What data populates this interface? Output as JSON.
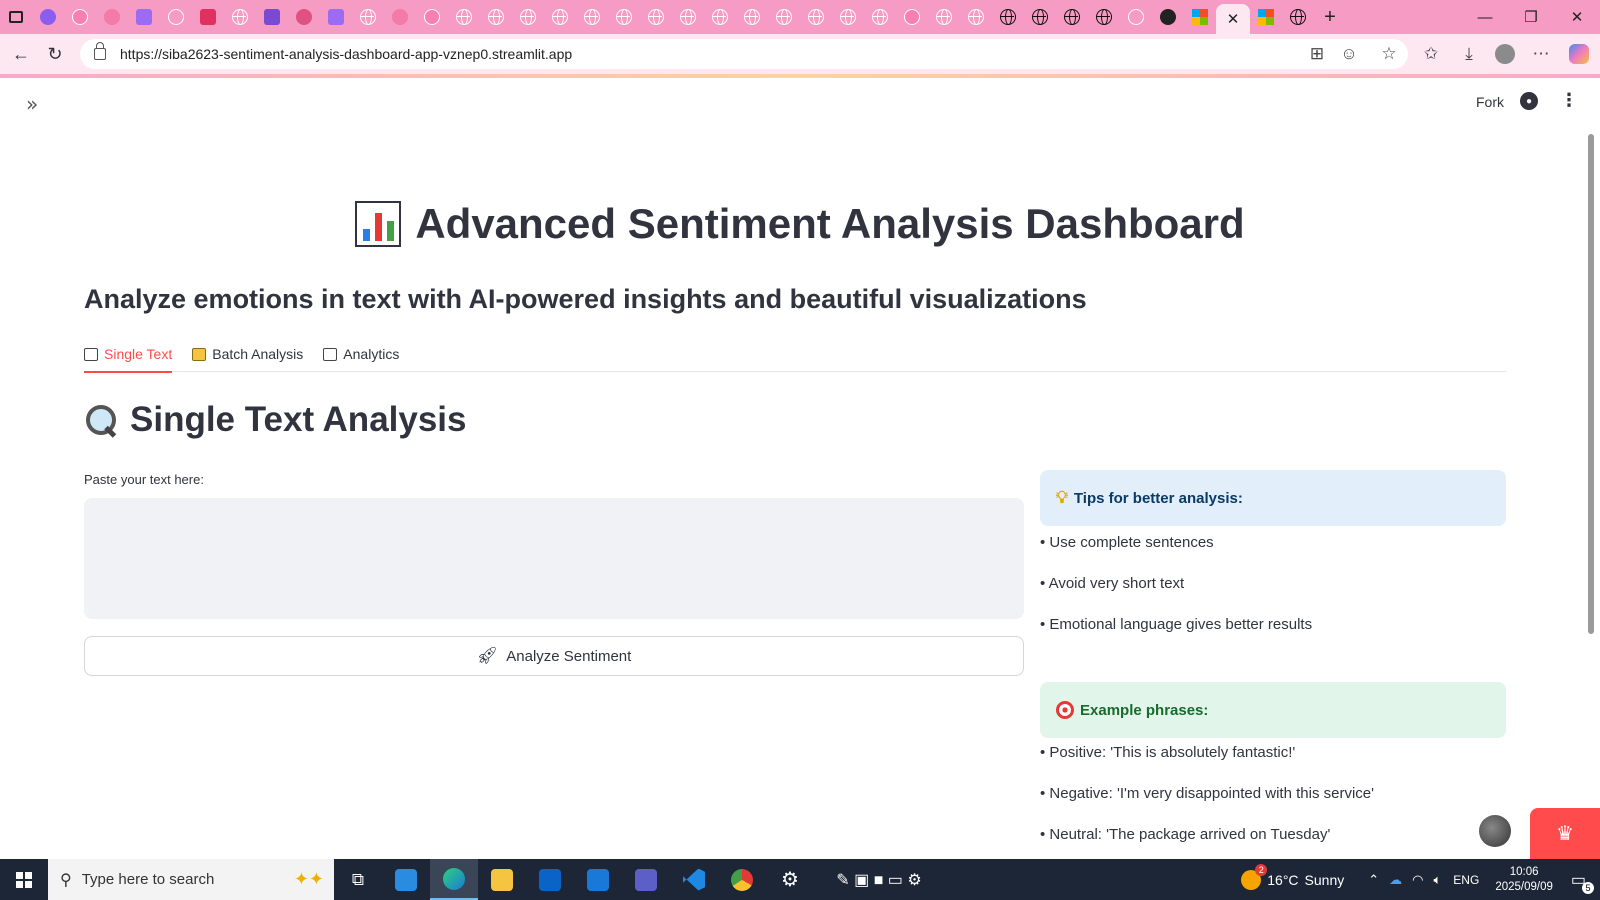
{
  "browser": {
    "url": "https://siba2623-sentiment-analysis-dashboard-app-vznep0.streamlit.app",
    "active_tab_close": "✕",
    "new_tab": "+"
  },
  "header": {
    "fork_label": "Fork"
  },
  "main": {
    "title": "Advanced Sentiment Analysis Dashboard",
    "subtitle": "Analyze emotions in text with AI-powered insights and beautiful visualizations",
    "tabs": [
      {
        "label": "Single Text",
        "active": true
      },
      {
        "label": "Batch Analysis",
        "active": false
      },
      {
        "label": "Analytics",
        "active": false
      }
    ],
    "section_title": "Single Text Analysis",
    "text_label": "Paste your text here:",
    "text_value": "",
    "analyze_label": "Analyze Sentiment"
  },
  "tips": {
    "heading": "Tips for better analysis:",
    "items": [
      "• Use complete sentences",
      "• Avoid very short text",
      "• Emotional language gives better results"
    ]
  },
  "examples": {
    "heading": "Example phrases:",
    "items": [
      "• Positive: 'This is absolutely fantastic!'",
      "• Negative: 'I'm very disappointed with this service'",
      "• Neutral: 'The package arrived on Tuesday'"
    ]
  },
  "taskbar": {
    "search_placeholder": "Type here to search",
    "weather_temp": "16°C",
    "weather_cond": "Sunny",
    "weather_badge": "2",
    "language": "ENG",
    "time": "10:06",
    "date": "2025/09/09",
    "notifications": "5"
  },
  "colors": {
    "accent": "#ff4b4b",
    "tab_strip": "#f59bc4",
    "tips_bg": "#e2eef9",
    "examples_bg": "#e2f5ea"
  }
}
